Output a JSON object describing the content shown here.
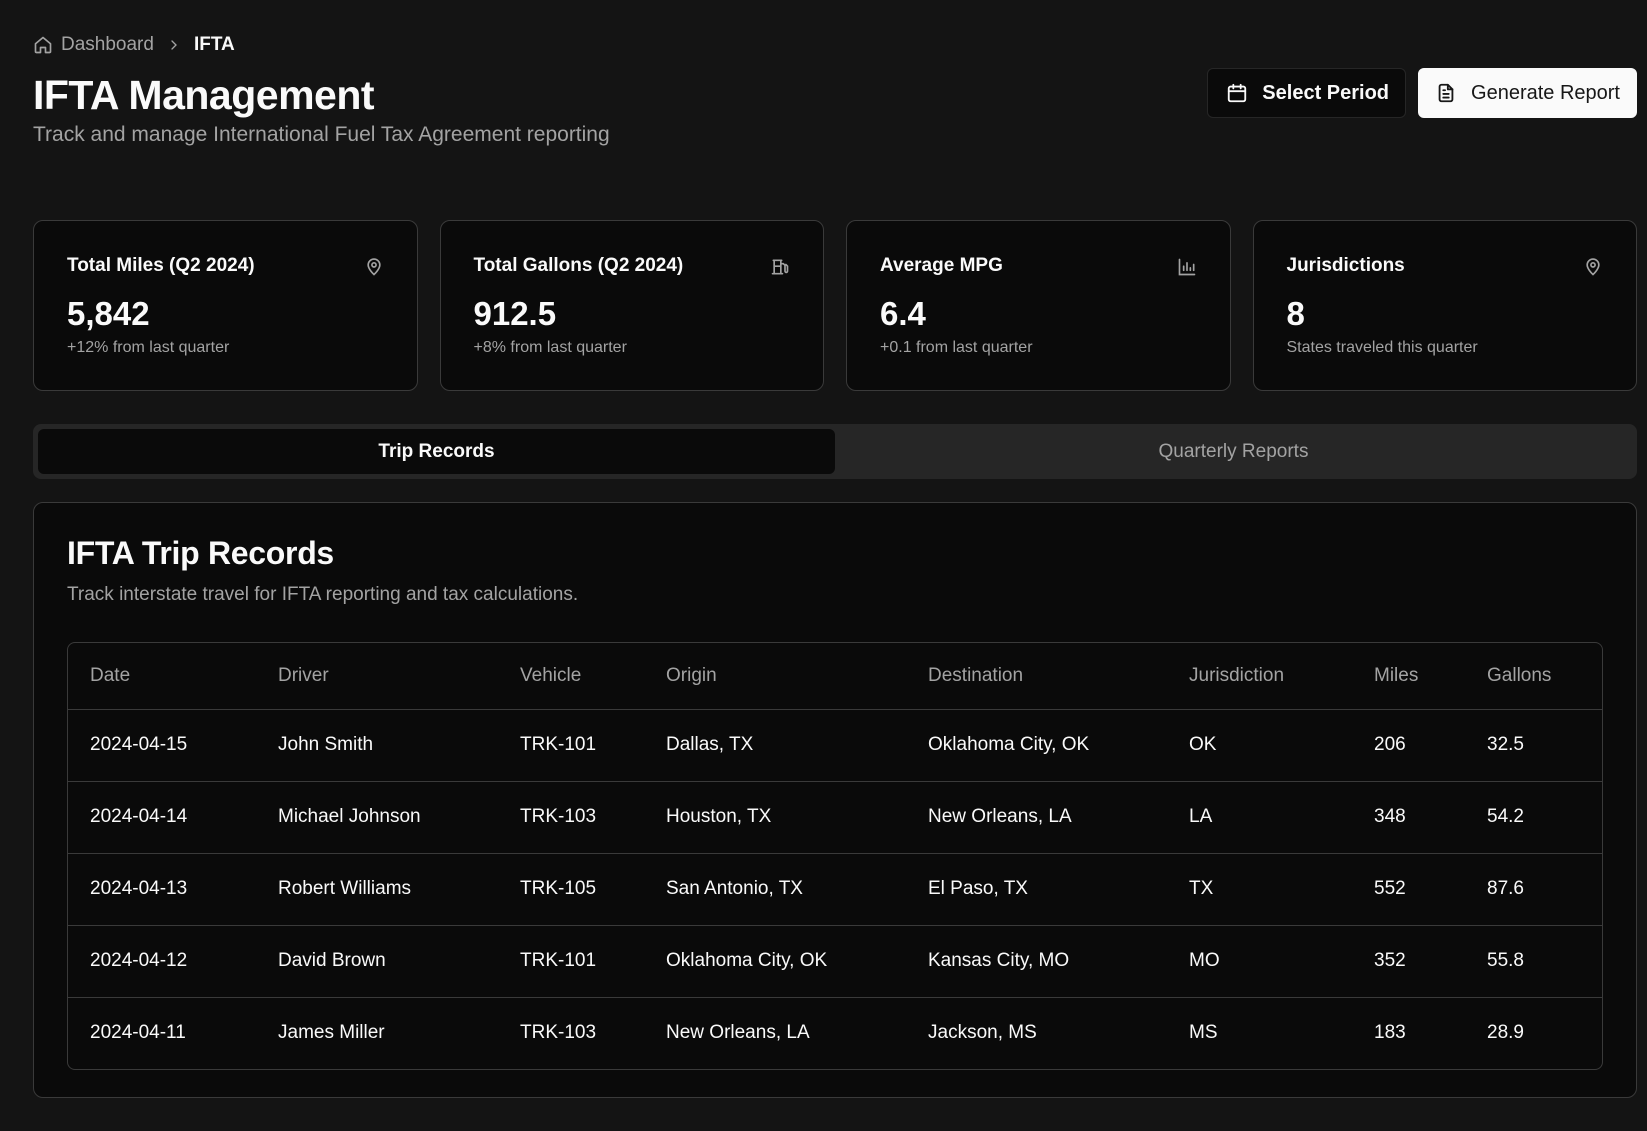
{
  "breadcrumb": {
    "home": "Dashboard",
    "current": "IFTA"
  },
  "header": {
    "title": "IFTA Management",
    "subtitle": "Track and manage International Fuel Tax Agreement reporting",
    "select_period": "Select Period",
    "generate_report": "Generate Report"
  },
  "stats": [
    {
      "label": "Total Miles (Q2 2024)",
      "value": "5,842",
      "change": "+12% from last quarter",
      "icon": "map-pin-icon"
    },
    {
      "label": "Total Gallons (Q2 2024)",
      "value": "912.5",
      "change": "+8% from last quarter",
      "icon": "fuel-icon"
    },
    {
      "label": "Average MPG",
      "value": "6.4",
      "change": "+0.1 from last quarter",
      "icon": "bar-chart-icon"
    },
    {
      "label": "Jurisdictions",
      "value": "8",
      "change": "States traveled this quarter",
      "icon": "map-pin-icon"
    }
  ],
  "tabs": [
    {
      "label": "Trip Records",
      "active": true
    },
    {
      "label": "Quarterly Reports",
      "active": false
    }
  ],
  "records": {
    "title": "IFTA Trip Records",
    "description": "Track interstate travel for IFTA reporting and tax calculations.",
    "columns": [
      "Date",
      "Driver",
      "Vehicle",
      "Origin",
      "Destination",
      "Jurisdiction",
      "Miles",
      "Gallons"
    ],
    "rows": [
      [
        "2024-04-15",
        "John Smith",
        "TRK-101",
        "Dallas, TX",
        "Oklahoma City, OK",
        "OK",
        "206",
        "32.5"
      ],
      [
        "2024-04-14",
        "Michael Johnson",
        "TRK-103",
        "Houston, TX",
        "New Orleans, LA",
        "LA",
        "348",
        "54.2"
      ],
      [
        "2024-04-13",
        "Robert Williams",
        "TRK-105",
        "San Antonio, TX",
        "El Paso, TX",
        "TX",
        "552",
        "87.6"
      ],
      [
        "2024-04-12",
        "David Brown",
        "TRK-101",
        "Oklahoma City, OK",
        "Kansas City, MO",
        "MO",
        "352",
        "55.8"
      ],
      [
        "2024-04-11",
        "James Miller",
        "TRK-103",
        "New Orleans, LA",
        "Jackson, MS",
        "MS",
        "183",
        "28.9"
      ]
    ]
  }
}
